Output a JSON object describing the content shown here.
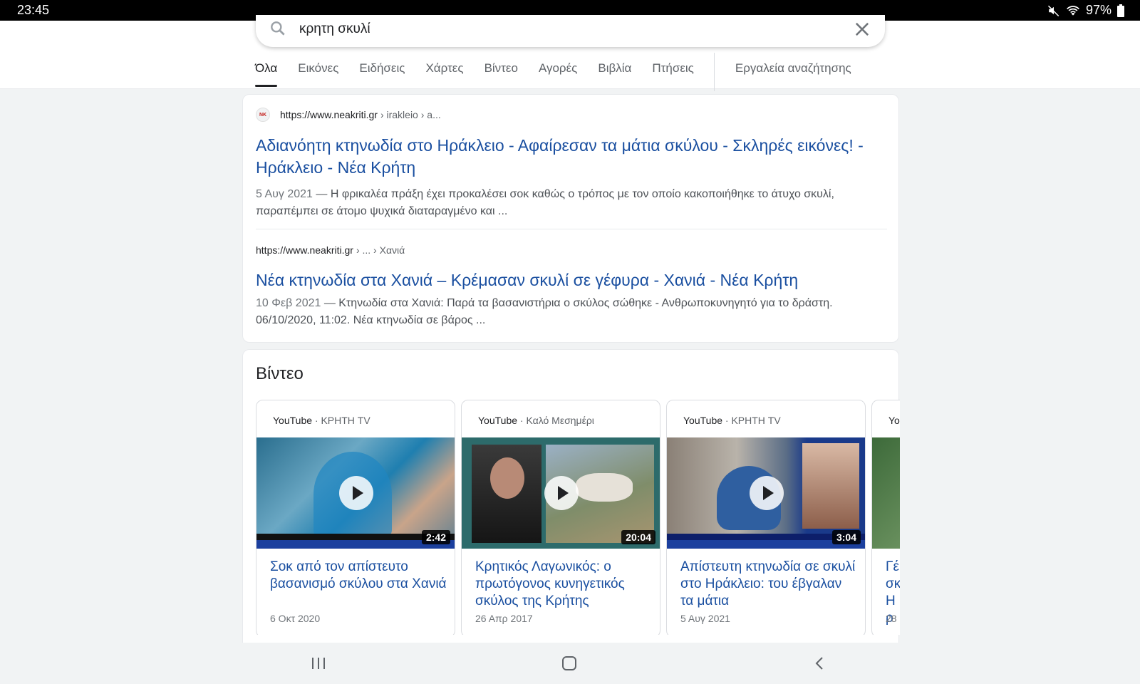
{
  "status_bar": {
    "time": "23:45",
    "battery": "97%"
  },
  "search": {
    "query": "κρητη σκυλί"
  },
  "tabs": [
    {
      "label": "Όλα",
      "active": true
    },
    {
      "label": "Εικόνες"
    },
    {
      "label": "Ειδήσεις"
    },
    {
      "label": "Χάρτες"
    },
    {
      "label": "Βίντεο"
    },
    {
      "label": "Αγορές"
    },
    {
      "label": "Βιβλία"
    },
    {
      "label": "Πτήσεις"
    }
  ],
  "tools_label": "Εργαλεία αναζήτησης",
  "results": [
    {
      "url": "https://www.neakriti.gr",
      "path": "› irakleio › a...",
      "title": "Αδιανόητη κτηνωδία στο Ηράκλειο - Αφαίρεσαν τα μάτια σκύλου - Σκληρές εικόνες! - Ηράκλειο - Νέα Κρήτη",
      "date": "5 Αυγ 2021",
      "snippet": " — Η φρικαλέα πράξη έχει προκαλέσει σοκ καθώς ο τρόπος με τον οποίο κακοποιήθηκε το άτυχο σκυλί, παραπέμπει σε άτομο ψυχικά διαταραγμένο και ..."
    },
    {
      "url": "https://www.neakriti.gr",
      "path": "› ... › Χανιά",
      "title": "Νέα κτηνωδία στα Χανιά – Κρέμασαν σκυλί σε γέφυρα - Χανιά - Νέα Κρήτη",
      "date": "10 Φεβ 2021",
      "snippet": " — Κτηνωδία στα Χανιά: Παρά τα βασανιστήρια ο σκύλος σώθηκε - Ανθρωποκυνηγητό για το δράστη. 06/10/2020, 11:02. Νέα κτηνωδία σε βάρος ..."
    }
  ],
  "videos": {
    "heading": "Βίντεο",
    "items": [
      {
        "source": "YouTube",
        "channel": "· ΚΡΗΤΗ TV",
        "duration": "2:42",
        "title": "Σοκ από τον απίστευτο βασανισμό σκύλου στα Χανιά",
        "date": "6 Οκτ 2020"
      },
      {
        "source": "YouTube",
        "channel": "· Καλό Μεσημέρι",
        "duration": "20:04",
        "title": "Κρητικός Λαγωνικός: ο πρωτόγονος κυνηγετικός σκύλος της Κρήτης",
        "date": "26 Απρ 2017"
      },
      {
        "source": "YouTube",
        "channel": "· ΚΡΗΤΗ TV",
        "duration": "3:04",
        "title": "Απίστευτη κτηνωδία σε σκυλί στο Ηράκλειο: του έβγαλαν τα μάτια",
        "date": "5 Αυγ 2021"
      },
      {
        "source": "Yo",
        "channel": "",
        "duration": "",
        "title": "Γέ σκ Ηρ",
        "date": "28"
      }
    ]
  }
}
